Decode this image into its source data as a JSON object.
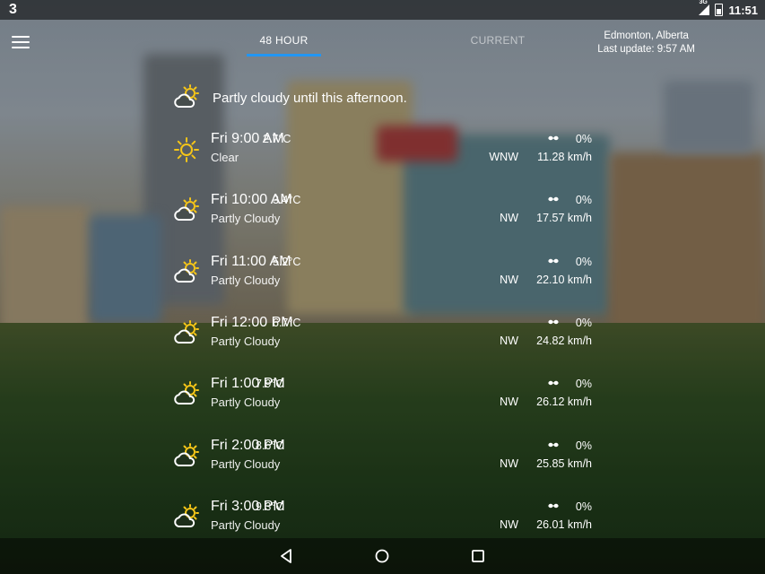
{
  "status_bar": {
    "notification": "3",
    "network": "3G",
    "time": "11:51"
  },
  "tabs": [
    {
      "label": "48 HOUR",
      "active": true
    },
    {
      "label": "CURRENT",
      "active": false
    }
  ],
  "location": {
    "city": "Edmonton, Alberta",
    "last_update": "Last update: 9:57 AM"
  },
  "summary": {
    "icon": "partly-cloudy-icon",
    "text": "Partly cloudy until this afternoon."
  },
  "forecast": [
    {
      "time": "Fri 9:00 AM",
      "temp": "2.7°C",
      "condition": "Clear",
      "icon": "sun-icon",
      "precip": "0%",
      "wind_dir": "WNW",
      "wind_speed": "11.28 km/h"
    },
    {
      "time": "Fri 10:00 AM",
      "temp": "3.4°C",
      "condition": "Partly Cloudy",
      "icon": "partly-cloudy-icon",
      "precip": "0%",
      "wind_dir": "NW",
      "wind_speed": "17.57 km/h"
    },
    {
      "time": "Fri 11:00 AM",
      "temp": "5.2°C",
      "condition": "Partly Cloudy",
      "icon": "partly-cloudy-icon",
      "precip": "0%",
      "wind_dir": "NW",
      "wind_speed": "22.10 km/h"
    },
    {
      "time": "Fri 12:00 PM",
      "temp": "6.7°C",
      "condition": "Partly Cloudy",
      "icon": "partly-cloudy-icon",
      "precip": "0%",
      "wind_dir": "NW",
      "wind_speed": "24.82 km/h"
    },
    {
      "time": "Fri 1:00 PM",
      "temp": "7.9°C",
      "condition": "Partly Cloudy",
      "icon": "partly-cloudy-icon",
      "precip": "0%",
      "wind_dir": "NW",
      "wind_speed": "26.12 km/h"
    },
    {
      "time": "Fri 2:00 PM",
      "temp": "8.6°C",
      "condition": "Partly Cloudy",
      "icon": "partly-cloudy-icon",
      "precip": "0%",
      "wind_dir": "NW",
      "wind_speed": "25.85 km/h"
    },
    {
      "time": "Fri 3:00 PM",
      "temp": "9.3°C",
      "condition": "Partly Cloudy",
      "icon": "partly-cloudy-icon",
      "precip": "0%",
      "wind_dir": "NW",
      "wind_speed": "26.01 km/h"
    }
  ],
  "nav_bar": {
    "back": "back-icon",
    "home": "home-icon",
    "recents": "recents-icon"
  },
  "colors": {
    "accent": "#2196f3",
    "sun": "#f5c518"
  }
}
